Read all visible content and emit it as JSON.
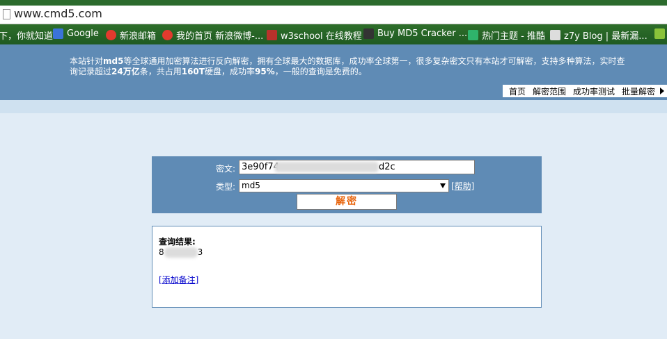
{
  "browser": {
    "url": "www.cmd5.com",
    "bookmarks": [
      {
        "label": "下，你就知道",
        "icon": "baidu-icon"
      },
      {
        "label": "Google",
        "icon": "google-icon"
      },
      {
        "label": "新浪邮箱",
        "icon": "weibo-icon"
      },
      {
        "label": "我的首页 新浪微博-...",
        "icon": "weibo-icon"
      },
      {
        "label": "w3school 在线教程",
        "icon": "w3school-icon"
      },
      {
        "label": "Buy MD5 Cracker ...",
        "icon": "md5-icon"
      },
      {
        "label": "热门主题 - 推酷",
        "icon": "tuicool-icon"
      },
      {
        "label": "z7y Blog | 最新漏...",
        "icon": "z7y-icon"
      }
    ]
  },
  "banner": {
    "text_prefix": "本站针对",
    "text_bold1": "md5",
    "text_mid1": "等全球通用加密算法进行反向解密，拥有全球最大的数据库，成功率全球第一，很多复杂密文只有本站才可解密，支持多种算法，实时查询记录超过",
    "text_bold2": "24万亿",
    "text_mid2": "条，共占用",
    "text_bold3": "160T",
    "text_mid3": "硬盘，成功率",
    "text_bold4": "95%",
    "text_suffix": "，一般的查询是免费的。"
  },
  "nav": [
    "首页",
    "解密范围",
    "成功率测试",
    "批量解密"
  ],
  "form": {
    "cipher_label": "密文:",
    "cipher_value_start": "3e90f74",
    "cipher_value_end": "d2c",
    "type_label": "类型:",
    "type_value": "md5",
    "help_label": "[帮助]",
    "submit_label": "解密"
  },
  "result": {
    "title": "查询结果:",
    "value_start": "8",
    "value_end": "3",
    "add_note_label": "[添加备注]"
  },
  "colors": {
    "banner": "#5f8bb5",
    "background": "#e1ecf6",
    "submit_text": "#e8640c",
    "bookmark_bar": "#2e6e2a"
  }
}
